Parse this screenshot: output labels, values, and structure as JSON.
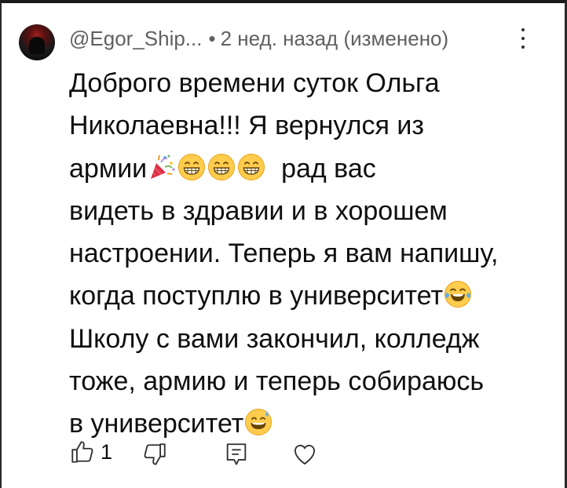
{
  "comment": {
    "author": "@Egor_Ship...",
    "separator": "•",
    "time": "2 нед. назад (изменено)",
    "lines": [
      {
        "parts": [
          {
            "t": "Доброго времени суток Ольга"
          }
        ]
      },
      {
        "parts": [
          {
            "t": "Николаевна!!! Я вернулся из"
          }
        ]
      },
      {
        "parts": [
          {
            "t": "армии"
          },
          {
            "e": "party-popper-emoji"
          },
          {
            "e": "grinning-face-emoji"
          },
          {
            "e": "grinning-face-emoji"
          },
          {
            "e": "grinning-face-emoji"
          },
          {
            "t": "  рад вас"
          }
        ]
      },
      {
        "parts": [
          {
            "t": "видеть в здравии и в хорошем"
          }
        ]
      },
      {
        "parts": [
          {
            "t": "настроении. Теперь я вам напишу,"
          }
        ]
      },
      {
        "parts": [
          {
            "t": "когда поступлю в университет"
          },
          {
            "e": "tears-of-joy-emoji"
          }
        ]
      },
      {
        "parts": [
          {
            "t": "Школу с вами закончил, колледж"
          }
        ]
      },
      {
        "parts": [
          {
            "t": "тоже, армию и теперь собираюсь"
          }
        ]
      },
      {
        "parts": [
          {
            "t": "в университет"
          },
          {
            "e": "grinning-sweat-emoji"
          }
        ]
      }
    ]
  },
  "actions": {
    "like_count": "1",
    "icons": {
      "like": "thumbs-up-icon",
      "dislike": "thumbs-down-icon",
      "reply": "reply-icon",
      "heart": "heart-icon",
      "menu": "more-vertical-icon"
    }
  },
  "colors": {
    "text": "#0f0f0f",
    "meta": "#606060",
    "icon": "#303030"
  }
}
